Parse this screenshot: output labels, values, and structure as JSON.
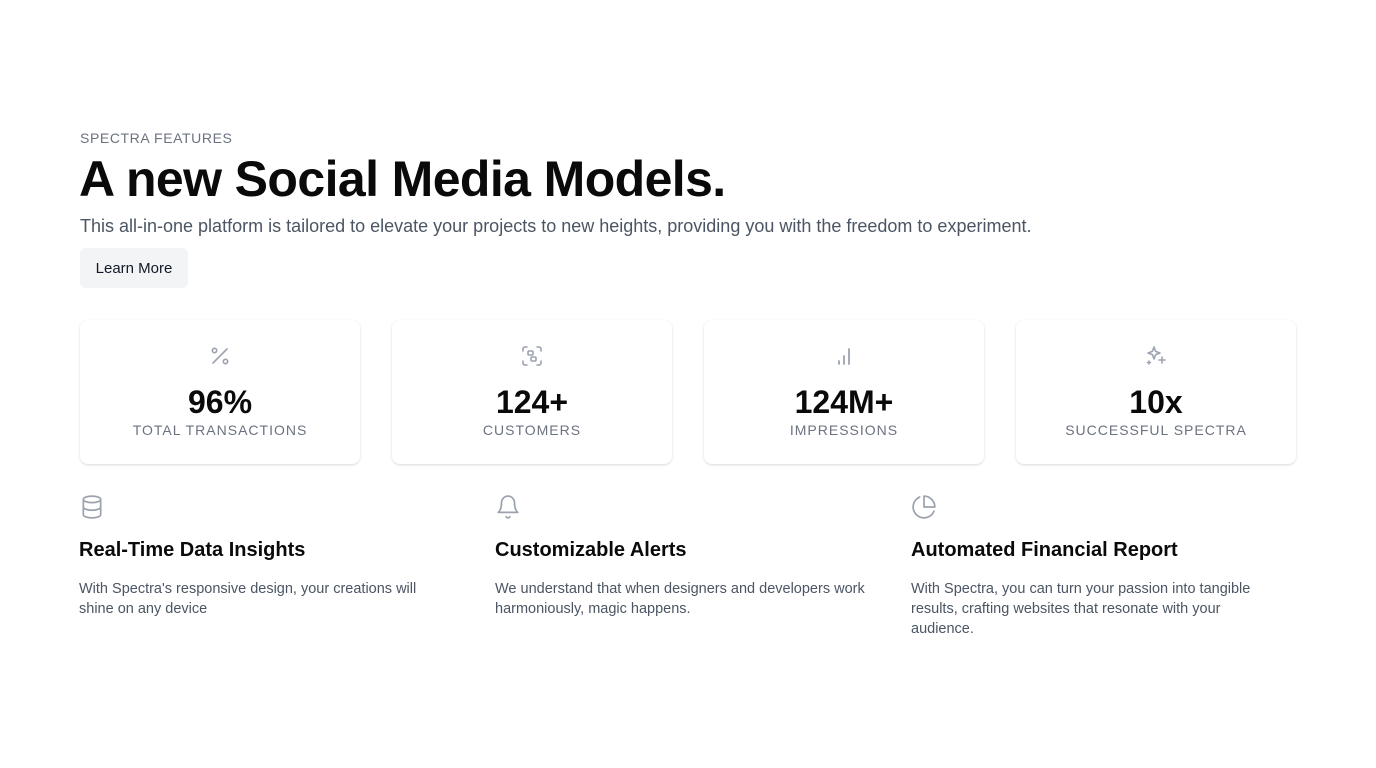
{
  "hero": {
    "eyebrow": "SPECTRA FEATURES",
    "headline": "A new Social Media Models.",
    "subtitle": "This all-in-one platform is tailored to elevate your projects to new heights, providing you with the freedom to experiment.",
    "cta_label": "Learn More"
  },
  "stats": [
    {
      "icon": "percent-icon",
      "value": "96%",
      "label": "TOTAL TRANSACTIONS"
    },
    {
      "icon": "scan-users-icon",
      "value": "124+",
      "label": "CUSTOMERS"
    },
    {
      "icon": "bar-chart-icon",
      "value": "124M+",
      "label": "IMPRESSIONS"
    },
    {
      "icon": "sparkles-icon",
      "value": "10x",
      "label": "SUCCESSFUL SPECTRA"
    }
  ],
  "features": [
    {
      "icon": "database-icon",
      "title": "Real-Time Data Insights",
      "description": "With Spectra's responsive design, your creations will shine on any device"
    },
    {
      "icon": "bell-icon",
      "title": "Customizable Alerts",
      "description": "We understand that when designers and developers work harmoniously, magic happens."
    },
    {
      "icon": "pie-chart-icon",
      "title": "Automated Financial Report",
      "description": "With Spectra, you can turn your passion into tangible results, crafting websites that resonate with your audience."
    }
  ],
  "colors": {
    "icon": "#9ca3af",
    "muted_text": "#6b7280",
    "body_text": "#4b5563",
    "button_bg": "#f3f4f6"
  }
}
